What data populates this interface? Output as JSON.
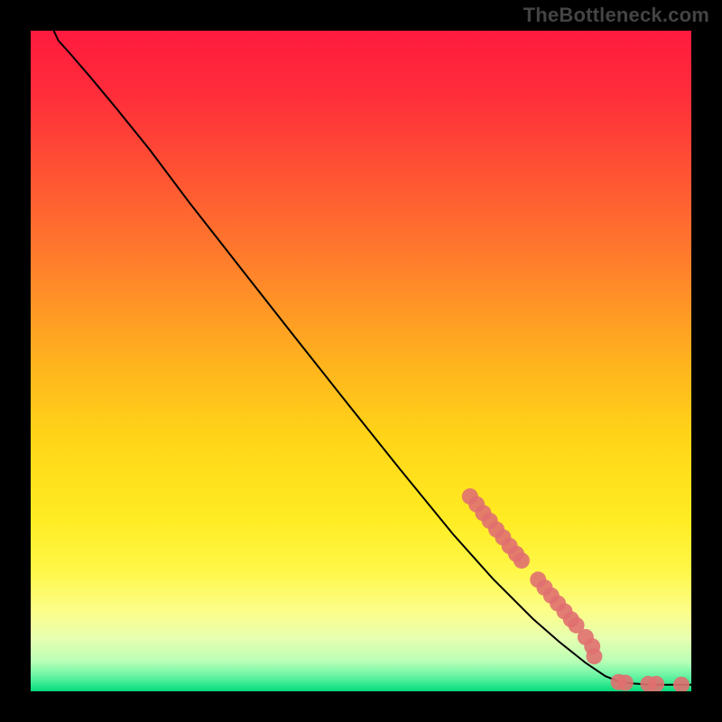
{
  "watermark": "TheBottleneck.com",
  "gradient": {
    "stops": [
      {
        "offset": 0.0,
        "color": "#ff1a3f"
      },
      {
        "offset": 0.1,
        "color": "#ff2e3a"
      },
      {
        "offset": 0.22,
        "color": "#ff5433"
      },
      {
        "offset": 0.35,
        "color": "#ff7e2c"
      },
      {
        "offset": 0.5,
        "color": "#ffb21e"
      },
      {
        "offset": 0.62,
        "color": "#ffd618"
      },
      {
        "offset": 0.74,
        "color": "#ffec22"
      },
      {
        "offset": 0.82,
        "color": "#fff84a"
      },
      {
        "offset": 0.88,
        "color": "#fcfe8b"
      },
      {
        "offset": 0.92,
        "color": "#e6ffb0"
      },
      {
        "offset": 0.955,
        "color": "#b8ffb6"
      },
      {
        "offset": 0.975,
        "color": "#70f5a6"
      },
      {
        "offset": 0.99,
        "color": "#2ee98f"
      },
      {
        "offset": 1.0,
        "color": "#07d77a"
      }
    ]
  },
  "chart_data": {
    "type": "line",
    "title": "",
    "xlabel": "",
    "ylabel": "",
    "xlim": [
      0,
      100
    ],
    "ylim": [
      0,
      100
    ],
    "series": [
      {
        "name": "curve",
        "style": "line",
        "color": "#000000",
        "points": [
          {
            "x": 3.5,
            "y": 100.0
          },
          {
            "x": 4.2,
            "y": 98.5
          },
          {
            "x": 6.0,
            "y": 96.5
          },
          {
            "x": 9.0,
            "y": 93.0
          },
          {
            "x": 13.0,
            "y": 88.2
          },
          {
            "x": 18.0,
            "y": 82.0
          },
          {
            "x": 24.0,
            "y": 74.0
          },
          {
            "x": 32.0,
            "y": 63.8
          },
          {
            "x": 40.0,
            "y": 53.6
          },
          {
            "x": 48.0,
            "y": 43.5
          },
          {
            "x": 56.0,
            "y": 33.5
          },
          {
            "x": 64.0,
            "y": 23.7
          },
          {
            "x": 70.0,
            "y": 17.0
          },
          {
            "x": 76.0,
            "y": 11.0
          },
          {
            "x": 80.0,
            "y": 7.5
          },
          {
            "x": 84.0,
            "y": 4.3
          },
          {
            "x": 87.0,
            "y": 2.3
          },
          {
            "x": 89.0,
            "y": 1.5
          },
          {
            "x": 91.0,
            "y": 1.2
          },
          {
            "x": 94.0,
            "y": 1.0
          },
          {
            "x": 97.0,
            "y": 1.0
          },
          {
            "x": 100.0,
            "y": 1.0
          }
        ]
      },
      {
        "name": "markers",
        "style": "points",
        "color": "#e07070",
        "points": [
          {
            "x": 66.5,
            "y": 29.5
          },
          {
            "x": 67.5,
            "y": 28.3
          },
          {
            "x": 68.5,
            "y": 27.0
          },
          {
            "x": 69.5,
            "y": 25.8
          },
          {
            "x": 70.5,
            "y": 24.5
          },
          {
            "x": 71.5,
            "y": 23.3
          },
          {
            "x": 72.5,
            "y": 22.0
          },
          {
            "x": 73.5,
            "y": 20.8
          },
          {
            "x": 74.3,
            "y": 19.8
          },
          {
            "x": 76.8,
            "y": 16.9
          },
          {
            "x": 77.8,
            "y": 15.7
          },
          {
            "x": 78.8,
            "y": 14.5
          },
          {
            "x": 79.8,
            "y": 13.3
          },
          {
            "x": 80.8,
            "y": 12.1
          },
          {
            "x": 81.8,
            "y": 10.9
          },
          {
            "x": 82.6,
            "y": 10.0
          },
          {
            "x": 84.0,
            "y": 8.2
          },
          {
            "x": 85.0,
            "y": 6.8
          },
          {
            "x": 85.3,
            "y": 5.3
          },
          {
            "x": 89.0,
            "y": 1.4
          },
          {
            "x": 90.0,
            "y": 1.3
          },
          {
            "x": 93.5,
            "y": 1.1
          },
          {
            "x": 94.7,
            "y": 1.1
          },
          {
            "x": 98.5,
            "y": 1.0
          }
        ]
      }
    ]
  }
}
